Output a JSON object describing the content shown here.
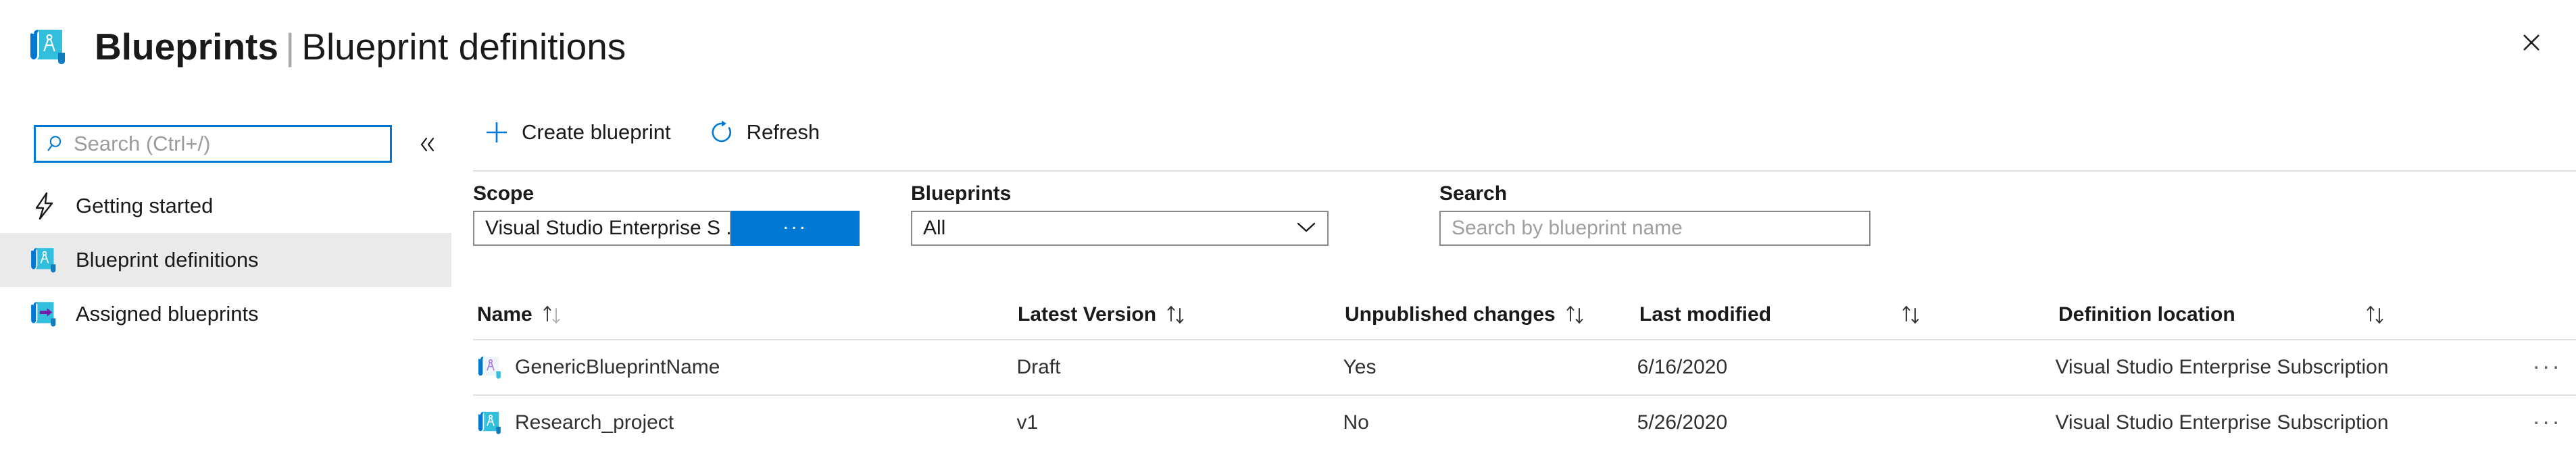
{
  "header": {
    "icon": "blueprint-scroll-icon",
    "title_primary": "Blueprints",
    "title_separator": "|",
    "title_secondary": "Blueprint definitions",
    "close_label": "✕"
  },
  "sidebar": {
    "search": {
      "placeholder": "Search (Ctrl+/)",
      "value": "",
      "icon": "search-icon"
    },
    "collapse_icon": "chevron-double-left-icon",
    "items": [
      {
        "label": "Getting started",
        "icon": "lightning-bolt-icon",
        "selected": false
      },
      {
        "label": "Blueprint definitions",
        "icon": "blueprint-scroll-icon",
        "selected": true
      },
      {
        "label": "Assigned blueprints",
        "icon": "blueprint-assigned-icon",
        "selected": false
      }
    ]
  },
  "toolbar": {
    "create_label": "Create blueprint",
    "create_icon": "plus-icon",
    "refresh_label": "Refresh",
    "refresh_icon": "refresh-icon"
  },
  "filters": {
    "scope": {
      "label": "Scope",
      "value": "Visual Studio Enterprise S  ...",
      "more_button_label": "...",
      "more_button_color": "#0078d4"
    },
    "blueprints": {
      "label": "Blueprints",
      "value": "All",
      "chevron_icon": "chevron-down-icon",
      "options": [
        "All"
      ]
    },
    "search": {
      "label": "Search",
      "placeholder": "Search by blueprint name",
      "value": ""
    }
  },
  "table": {
    "columns": [
      {
        "label": "Name",
        "sort_icon": "sort-updown-icon"
      },
      {
        "label": "Latest Version",
        "sort_icon": "sort-updown-icon"
      },
      {
        "label": "Unpublished changes",
        "sort_icon": "sort-updown-icon"
      },
      {
        "label": "Last modified",
        "sort_icon": "sort-updown-icon"
      },
      {
        "label": "Definition location",
        "sort_icon": "sort-updown-icon"
      }
    ],
    "rows": [
      {
        "icon": "blueprint-draft-icon",
        "name": "GenericBlueprintName",
        "latest_version": "Draft",
        "unpublished_changes": "Yes",
        "last_modified": "6/16/2020",
        "definition_location": "Visual Studio Enterprise Subscription",
        "actions_label": "..."
      },
      {
        "icon": "blueprint-published-icon",
        "name": "Research_project",
        "latest_version": "v1",
        "unpublished_changes": "No",
        "last_modified": "5/26/2020",
        "definition_location": "Visual Studio Enterprise Subscription",
        "actions_label": "..."
      }
    ]
  },
  "colors": {
    "accent": "#0078d4",
    "icon_cyan": "#32bedd",
    "icon_blue_dark": "#0078d4",
    "selected_row_bg": "#eaeaea",
    "divider": "#e1dfdd",
    "text": "#1b1a19",
    "placeholder": "#a19f9d",
    "draft_purple": "#a67ae0"
  }
}
